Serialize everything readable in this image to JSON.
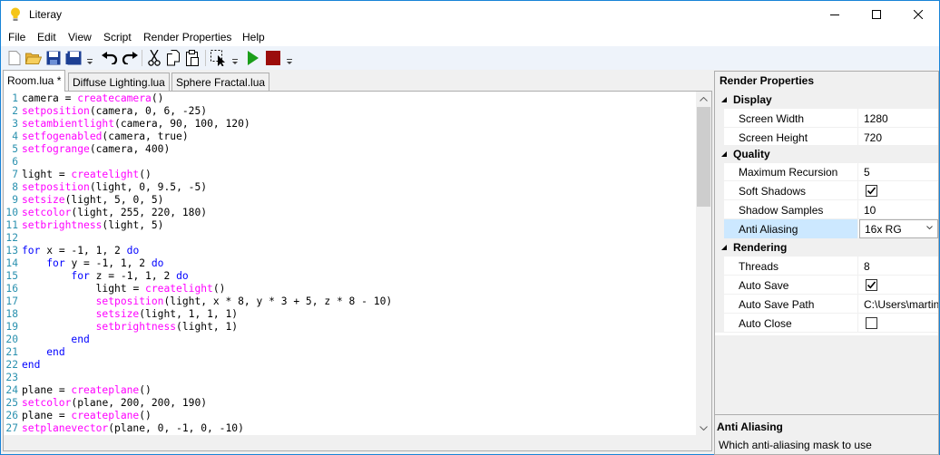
{
  "window": {
    "title": "Literay",
    "accent": "#1883d7"
  },
  "menu": [
    "File",
    "Edit",
    "View",
    "Script",
    "Render Properties",
    "Help"
  ],
  "toolbar": {
    "buttons": [
      "new-document-icon",
      "open-folder-icon",
      "save-icon",
      "save-all-icon",
      "undo-icon",
      "redo-icon",
      "cut-icon",
      "copy-icon",
      "paste-icon",
      "select-icon",
      "run-icon",
      "stop-icon"
    ]
  },
  "tabs": [
    {
      "label": "Room.lua *",
      "active": true
    },
    {
      "label": "Diffuse Lighting.lua",
      "active": false
    },
    {
      "label": "Sphere Fractal.lua",
      "active": false
    }
  ],
  "editor": {
    "lines": [
      {
        "n": "1",
        "code": "camera = createcamera()"
      },
      {
        "n": "2",
        "code": "setposition(camera, 0, 6, -25)"
      },
      {
        "n": "3",
        "code": "setambientlight(camera, 90, 100, 120)"
      },
      {
        "n": "4",
        "code": "setfogenabled(camera, true)"
      },
      {
        "n": "5",
        "code": "setfogrange(camera, 400)"
      },
      {
        "n": "6",
        "code": ""
      },
      {
        "n": "7",
        "code": "light = createlight()"
      },
      {
        "n": "8",
        "code": "setposition(light, 0, 9.5, -5)"
      },
      {
        "n": "9",
        "code": "setsize(light, 5, 0, 5)"
      },
      {
        "n": "10",
        "code": "setcolor(light, 255, 220, 180)"
      },
      {
        "n": "11",
        "code": "setbrightness(light, 5)"
      },
      {
        "n": "12",
        "code": ""
      },
      {
        "n": "13",
        "code": "for x = -1, 1, 2 do"
      },
      {
        "n": "14",
        "code": "    for y = -1, 1, 2 do"
      },
      {
        "n": "15",
        "code": "        for z = -1, 1, 2 do"
      },
      {
        "n": "16",
        "code": "            light = createlight()"
      },
      {
        "n": "17",
        "code": "            setposition(light, x * 8, y * 3 + 5, z * 8 - 10)"
      },
      {
        "n": "18",
        "code": "            setsize(light, 1, 1, 1)"
      },
      {
        "n": "19",
        "code": "            setbrightness(light, 1)"
      },
      {
        "n": "20",
        "code": "        end"
      },
      {
        "n": "21",
        "code": "    end"
      },
      {
        "n": "22",
        "code": "end"
      },
      {
        "n": "23",
        "code": ""
      },
      {
        "n": "24",
        "code": "plane = createplane()"
      },
      {
        "n": "25",
        "code": "setcolor(plane, 200, 200, 190)"
      },
      {
        "n": "26",
        "code": "plane = createplane()"
      },
      {
        "n": "27",
        "code": "setplanevector(plane, 0, -1, 0, -10)"
      }
    ],
    "keywords": [
      "for",
      "do",
      "end"
    ],
    "functions": [
      "createcamera",
      "setposition",
      "setambientlight",
      "setfogenabled",
      "setfogrange",
      "createlight",
      "setsize",
      "setcolor",
      "setbrightness",
      "createplane",
      "setplanevector"
    ],
    "colors": {
      "keyword": "#0000ff",
      "function": "#ff00ff",
      "line_number": "#2b91af"
    }
  },
  "properties": {
    "header": "Render Properties",
    "categories": [
      {
        "name": "Display",
        "rows": [
          {
            "name": "Screen Width",
            "value": "1280",
            "type": "text"
          },
          {
            "name": "Screen Height",
            "value": "720",
            "type": "text"
          }
        ]
      },
      {
        "name": "Quality",
        "rows": [
          {
            "name": "Maximum Recursion",
            "value": "5",
            "type": "text"
          },
          {
            "name": "Soft Shadows",
            "value": "",
            "type": "check",
            "checked": true
          },
          {
            "name": "Shadow Samples",
            "value": "10",
            "type": "text"
          },
          {
            "name": "Anti Aliasing",
            "value": "16x RG",
            "type": "combo",
            "selected": true
          }
        ]
      },
      {
        "name": "Rendering",
        "rows": [
          {
            "name": "Threads",
            "value": "8",
            "type": "text"
          },
          {
            "name": "Auto Save",
            "value": "",
            "type": "check",
            "checked": true
          },
          {
            "name": "Auto Save Path",
            "value": "C:\\Users\\martin",
            "type": "text"
          },
          {
            "name": "Auto Close",
            "value": "",
            "type": "check",
            "checked": false
          }
        ]
      }
    ],
    "help": {
      "title": "Anti Aliasing",
      "description": "Which anti-aliasing mask to use"
    },
    "selection_color": "#cce8ff"
  }
}
